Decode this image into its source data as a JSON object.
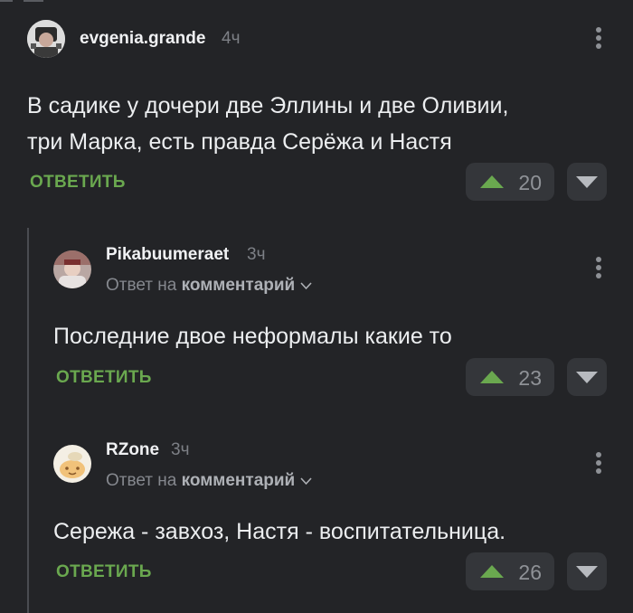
{
  "comments": [
    {
      "author": "evgenia.grande",
      "time": "4ч",
      "text_lines": [
        "В садике у дочери две Эллины и две Оливии,",
        "три Марка, есть правда Серёжа и Настя"
      ],
      "reply_label": "ОТВЕТИТЬ",
      "rating": "20"
    },
    {
      "author": "Pikabuumeraet",
      "time": "3ч",
      "reply_to_prefix": "Ответ на",
      "reply_to_target": "комментарий",
      "text_lines": [
        "Последние двое неформалы какие то"
      ],
      "reply_label": "ОТВЕТИТЬ",
      "rating": "23"
    },
    {
      "author": "RZone",
      "time": "3ч",
      "reply_to_prefix": "Ответ на",
      "reply_to_target": "комментарий",
      "text_lines": [
        "Сережа - завхоз, Настя - воспитательница."
      ],
      "reply_label": "ОТВЕТИТЬ",
      "rating": "26"
    }
  ],
  "colors": {
    "background": "#232427",
    "accent_green": "#6aa84f",
    "vote_bg": "#34363a",
    "muted_text": "#7d8086"
  },
  "icons": {
    "upvote": "triangle-up-icon",
    "downvote": "triangle-down-icon",
    "menu": "kebab-menu-icon",
    "expand": "chevron-down-icon"
  }
}
